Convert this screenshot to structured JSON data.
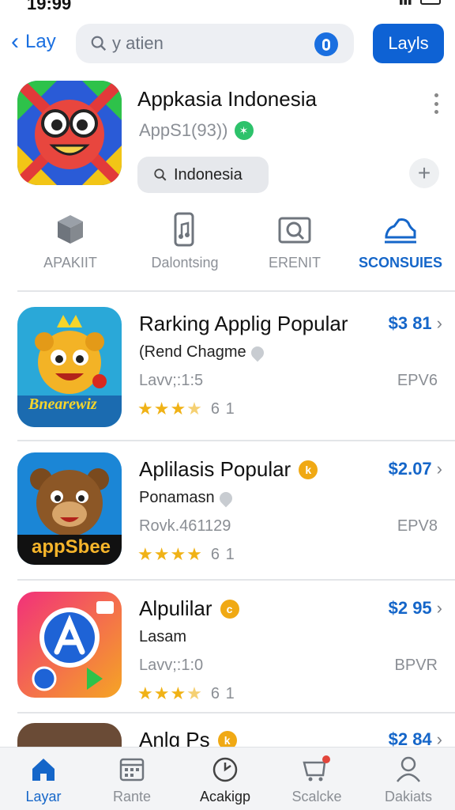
{
  "status": {
    "time": "19:99"
  },
  "top_bar": {
    "back_label": "Lay",
    "search_value": "y atien",
    "action_label": "Layls"
  },
  "app": {
    "title": "Appkasia Indonesia",
    "subtitle": "AppS1(93))",
    "region_chip": "Indonesia"
  },
  "categories": [
    {
      "label": "APAKIIT",
      "icon": "cube-icon"
    },
    {
      "label": "Dalontsing",
      "icon": "phone-music-icon"
    },
    {
      "label": "ERENIT",
      "icon": "photo-search-icon"
    },
    {
      "label": "SCONSUIES",
      "icon": "shoe-icon",
      "active": true
    }
  ],
  "apps": [
    {
      "title": "Rarking Applig Popular",
      "subtitle": "(Rend Chagme",
      "meta": "Lavv;:1:5",
      "rating_count": "6 1",
      "stars": 3.5,
      "price": "$3 81",
      "code": "EPV6",
      "icon_text": "Bnearewiz",
      "has_badge": false
    },
    {
      "title": "Aplilasis Popular",
      "subtitle": "Ponamasn",
      "meta": "Rovk.461129",
      "rating_count": "6 1",
      "stars": 4,
      "price": "$2.07",
      "code": "EPV8",
      "icon_text": "appSbee",
      "has_badge": true,
      "badge": "k"
    },
    {
      "title": "Alpulilar",
      "subtitle": "Lasam",
      "meta": "Lavv;:1:0",
      "rating_count": "6 1",
      "stars": 3.5,
      "price": "$2 95",
      "code": "BPVR",
      "icon_text": "",
      "has_badge": true,
      "badge": "c"
    },
    {
      "title": "Anlg Ps",
      "subtitle": "",
      "meta": "",
      "rating_count": "",
      "stars": 0,
      "price": "$2 84",
      "code": "",
      "icon_text": "",
      "has_badge": true,
      "badge": "k"
    }
  ],
  "bottom_nav": [
    {
      "label": "Layar",
      "icon": "home-icon",
      "active": true
    },
    {
      "label": "Rante",
      "icon": "calendar-icon"
    },
    {
      "label": "Acakigp",
      "icon": "clock-icon",
      "strong": true
    },
    {
      "label": "Scalcke",
      "icon": "cart-icon"
    },
    {
      "label": "Dakiats",
      "icon": "person-icon"
    }
  ],
  "colors": {
    "accent": "#1566c9",
    "button": "#0e62d4",
    "star": "#f0b216",
    "coin": "#f0a914",
    "verified": "#2dc26b"
  }
}
